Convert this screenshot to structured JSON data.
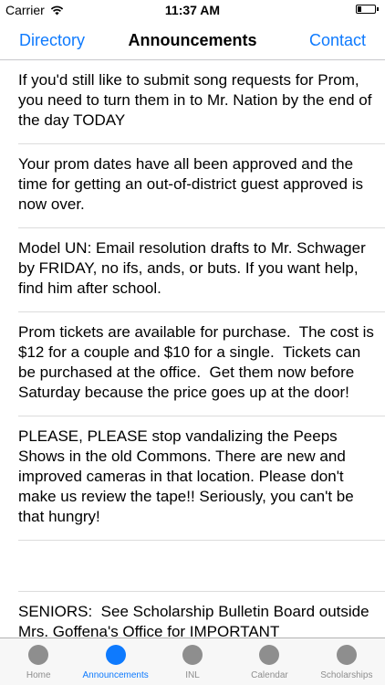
{
  "status_bar": {
    "carrier": "Carrier",
    "time": "11:37 AM"
  },
  "nav": {
    "left": "Directory",
    "title": "Announcements",
    "right": "Contact",
    "accent_color": "#0e7afe"
  },
  "announcements": [
    "If you'd still like to submit song requests for Prom, you need to turn them in to Mr. Nation by the end of the day TODAY",
    "Your prom dates have all been approved and the time for getting an out-of-district guest approved is now over.",
    "Model UN: Email resolution drafts to Mr. Schwager by FRIDAY, no ifs, ands, or buts. If you want help, find him after school.",
    "Prom tickets are available for purchase.  The cost is $12 for a couple and $10 for a single.  Tickets can be purchased at the office.  Get them now before Saturday because the price goes up at the door!",
    "PLEASE, PLEASE stop vandalizing the Peeps Shows in the old Commons. There are new and improved cameras in that location. Please don't make us review the tape!! Seriously, you can't be that hungry!",
    "",
    "SENIORS:  See Scholarship Bulletin Board outside Mrs. Goffena's Office for IMPORTANT"
  ],
  "tabs": [
    {
      "label": "Home",
      "active": false
    },
    {
      "label": "Announcements",
      "active": true
    },
    {
      "label": "INL",
      "active": false
    },
    {
      "label": "Calendar",
      "active": false
    },
    {
      "label": "Scholarships",
      "active": false
    }
  ]
}
